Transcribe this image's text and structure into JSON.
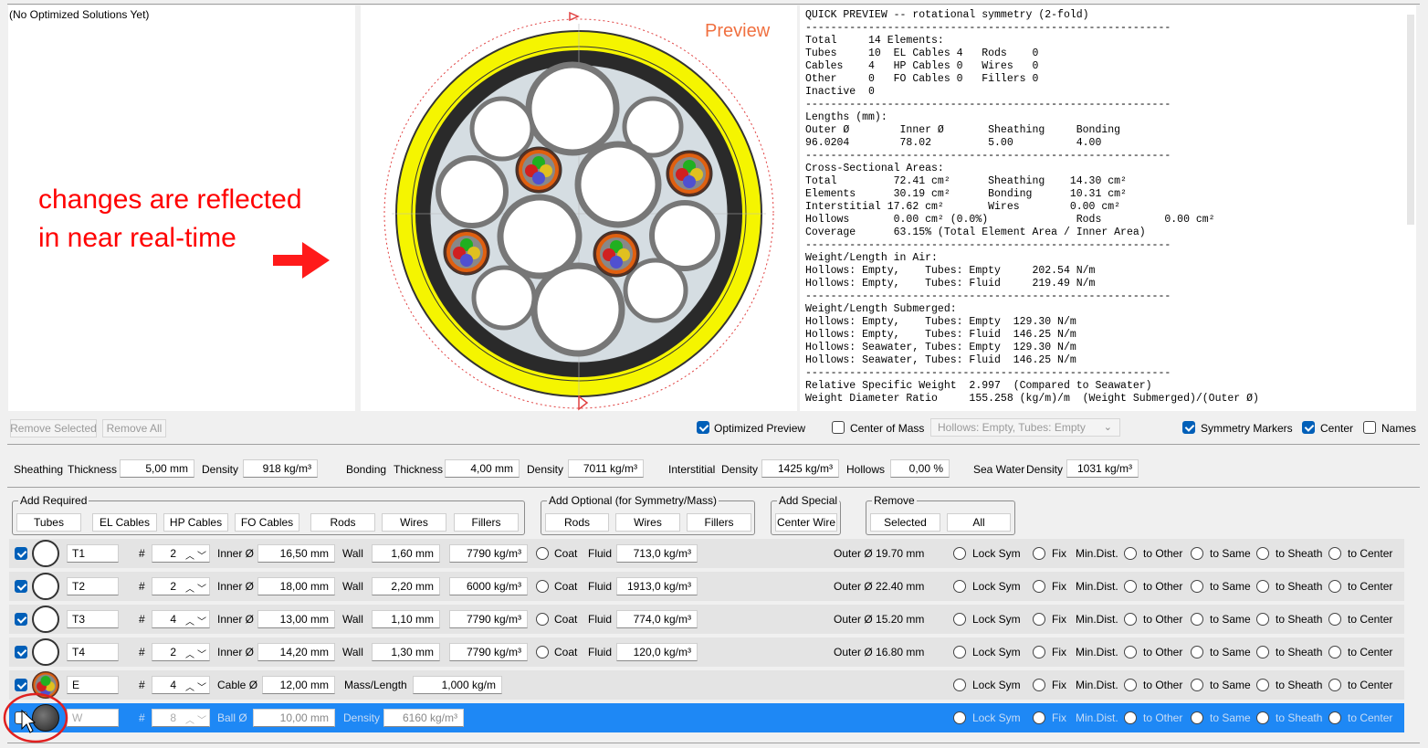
{
  "solutions_label": "(No Optimized Solutions Yet)",
  "annotation": {
    "line1": "changes are reflected",
    "line2": "in near real-time",
    "arrow_color": "#ff0000"
  },
  "preview_label": "Preview",
  "quick_preview_text": "QUICK PREVIEW -- rotational symmetry (2-fold)\n----------------------------------------------------------\nTotal     14 Elements:\nTubes     10  EL Cables 4   Rods    0\nCables    4   HP Cables 0   Wires   0\nOther     0   FO Cables 0   Fillers 0\nInactive  0\n----------------------------------------------------------\nLengths (mm):\nOuter Ø        Inner Ø       Sheathing     Bonding\n96.0204        78.02         5.00          4.00\n----------------------------------------------------------\nCross-Sectional Areas:\nTotal         72.41 cm²      Sheathing    14.30 cm²\nElements      30.19 cm²      Bonding      10.31 cm²\nInterstitial 17.62 cm²       Wires        0.00 cm²\nHollows       0.00 cm² (0.0%)              Rods          0.00 cm²\nCoverage      63.15% (Total Element Area / Inner Area)\n----------------------------------------------------------\nWeight/Length in Air:\nHollows: Empty,    Tubes: Empty     202.54 N/m\nHollows: Empty,    Tubes: Fluid     219.49 N/m\n----------------------------------------------------------\nWeight/Length Submerged:\nHollows: Empty,    Tubes: Empty  129.30 N/m\nHollows: Empty,    Tubes: Fluid  146.25 N/m\nHollows: Seawater, Tubes: Empty  129.30 N/m\nHollows: Seawater, Tubes: Fluid  146.25 N/m\n----------------------------------------------------------\nRelative Specific Weight  2.997  (Compared to Seawater)\nWeight Diameter Ratio     155.258 (kg/m)/m  (Weight Submerged)/(Outer Ø)",
  "toolbar": {
    "remove_selected": "Remove Selected",
    "remove_all": "Remove All",
    "optimized_preview": "Optimized Preview",
    "center_of_mass": "Center of Mass",
    "mass_case": "Hollows: Empty, Tubes: Empty",
    "symmetry_markers": "Symmetry Markers",
    "center": "Center",
    "names": "Names"
  },
  "params": {
    "sheathing": "Sheathing",
    "thickness": "Thickness",
    "sheathing_thickness": "5,00 mm",
    "density": "Density",
    "sheathing_density": "918 kg/m³",
    "bonding": "Bonding",
    "bonding_thickness": "4,00 mm",
    "bonding_density": "7011 kg/m³",
    "interstitial": "Interstitial",
    "interstitial_density": "1425 kg/m³",
    "hollows": "Hollows",
    "hollows_value": "0,00 %",
    "sea_water": "Sea Water",
    "sea_water_density": "1031 kg/m³"
  },
  "groups": {
    "required": {
      "title": "Add Required",
      "buttons": [
        "Tubes",
        "EL Cables",
        "HP Cables",
        "FO Cables",
        "Rods",
        "Wires",
        "Fillers"
      ]
    },
    "optional": {
      "title": "Add Optional (for Symmetry/Mass)",
      "buttons": [
        "Rods",
        "Wires",
        "Fillers"
      ]
    },
    "special": {
      "title": "Add Special",
      "buttons": [
        "Center Wire"
      ]
    },
    "remove": {
      "title": "Remove",
      "buttons": [
        "Selected",
        "All"
      ]
    }
  },
  "row_labels": {
    "hash": "#",
    "inner": "Inner Ø",
    "wall": "Wall",
    "coat": "Coat",
    "fluid": "Fluid",
    "cable": "Cable Ø",
    "mass_length": "Mass/Length",
    "ball": "Ball Ø",
    "density": "Density",
    "lock_sym": "Lock Sym",
    "fix": "Fix",
    "min_dist": "Min.Dist.",
    "to_other": "to Other",
    "to_same": "to Same",
    "to_sheath": "to Sheath",
    "to_center": "to Center"
  },
  "rows": [
    {
      "type": "tube",
      "name": "T1",
      "count": "2",
      "inner": "16,50 mm",
      "wall": "1,60 mm",
      "density": "7790 kg/m³",
      "fluid": "713,0 kg/m³",
      "outer": "Outer Ø 19.70 mm"
    },
    {
      "type": "tube",
      "name": "T2",
      "count": "2",
      "inner": "18,00 mm",
      "wall": "2,20 mm",
      "density": "6000 kg/m³",
      "fluid": "1913,0 kg/m³",
      "outer": "Outer Ø 22.40 mm"
    },
    {
      "type": "tube",
      "name": "T3",
      "count": "4",
      "inner": "13,00 mm",
      "wall": "1,10 mm",
      "density": "7790 kg/m³",
      "fluid": "774,0 kg/m³",
      "outer": "Outer Ø 15.20 mm"
    },
    {
      "type": "tube",
      "name": "T4",
      "count": "2",
      "inner": "14,20 mm",
      "wall": "1,30 mm",
      "density": "7790 kg/m³",
      "fluid": "120,0 kg/m³",
      "outer": "Outer Ø 16.80 mm"
    },
    {
      "type": "cable",
      "name": "E",
      "count": "4",
      "cable": "12,00 mm",
      "mass": "1,000 kg/m"
    },
    {
      "type": "wire",
      "name": "W",
      "count": "8",
      "ball": "10,00 mm",
      "density": "6160 kg/m³"
    }
  ],
  "colors": {
    "selection": "#1e88f5",
    "sheath": "#f5f500",
    "bonding": "#2a2a2a",
    "inner": "#d5dde2",
    "annotation": "#ff0000"
  }
}
